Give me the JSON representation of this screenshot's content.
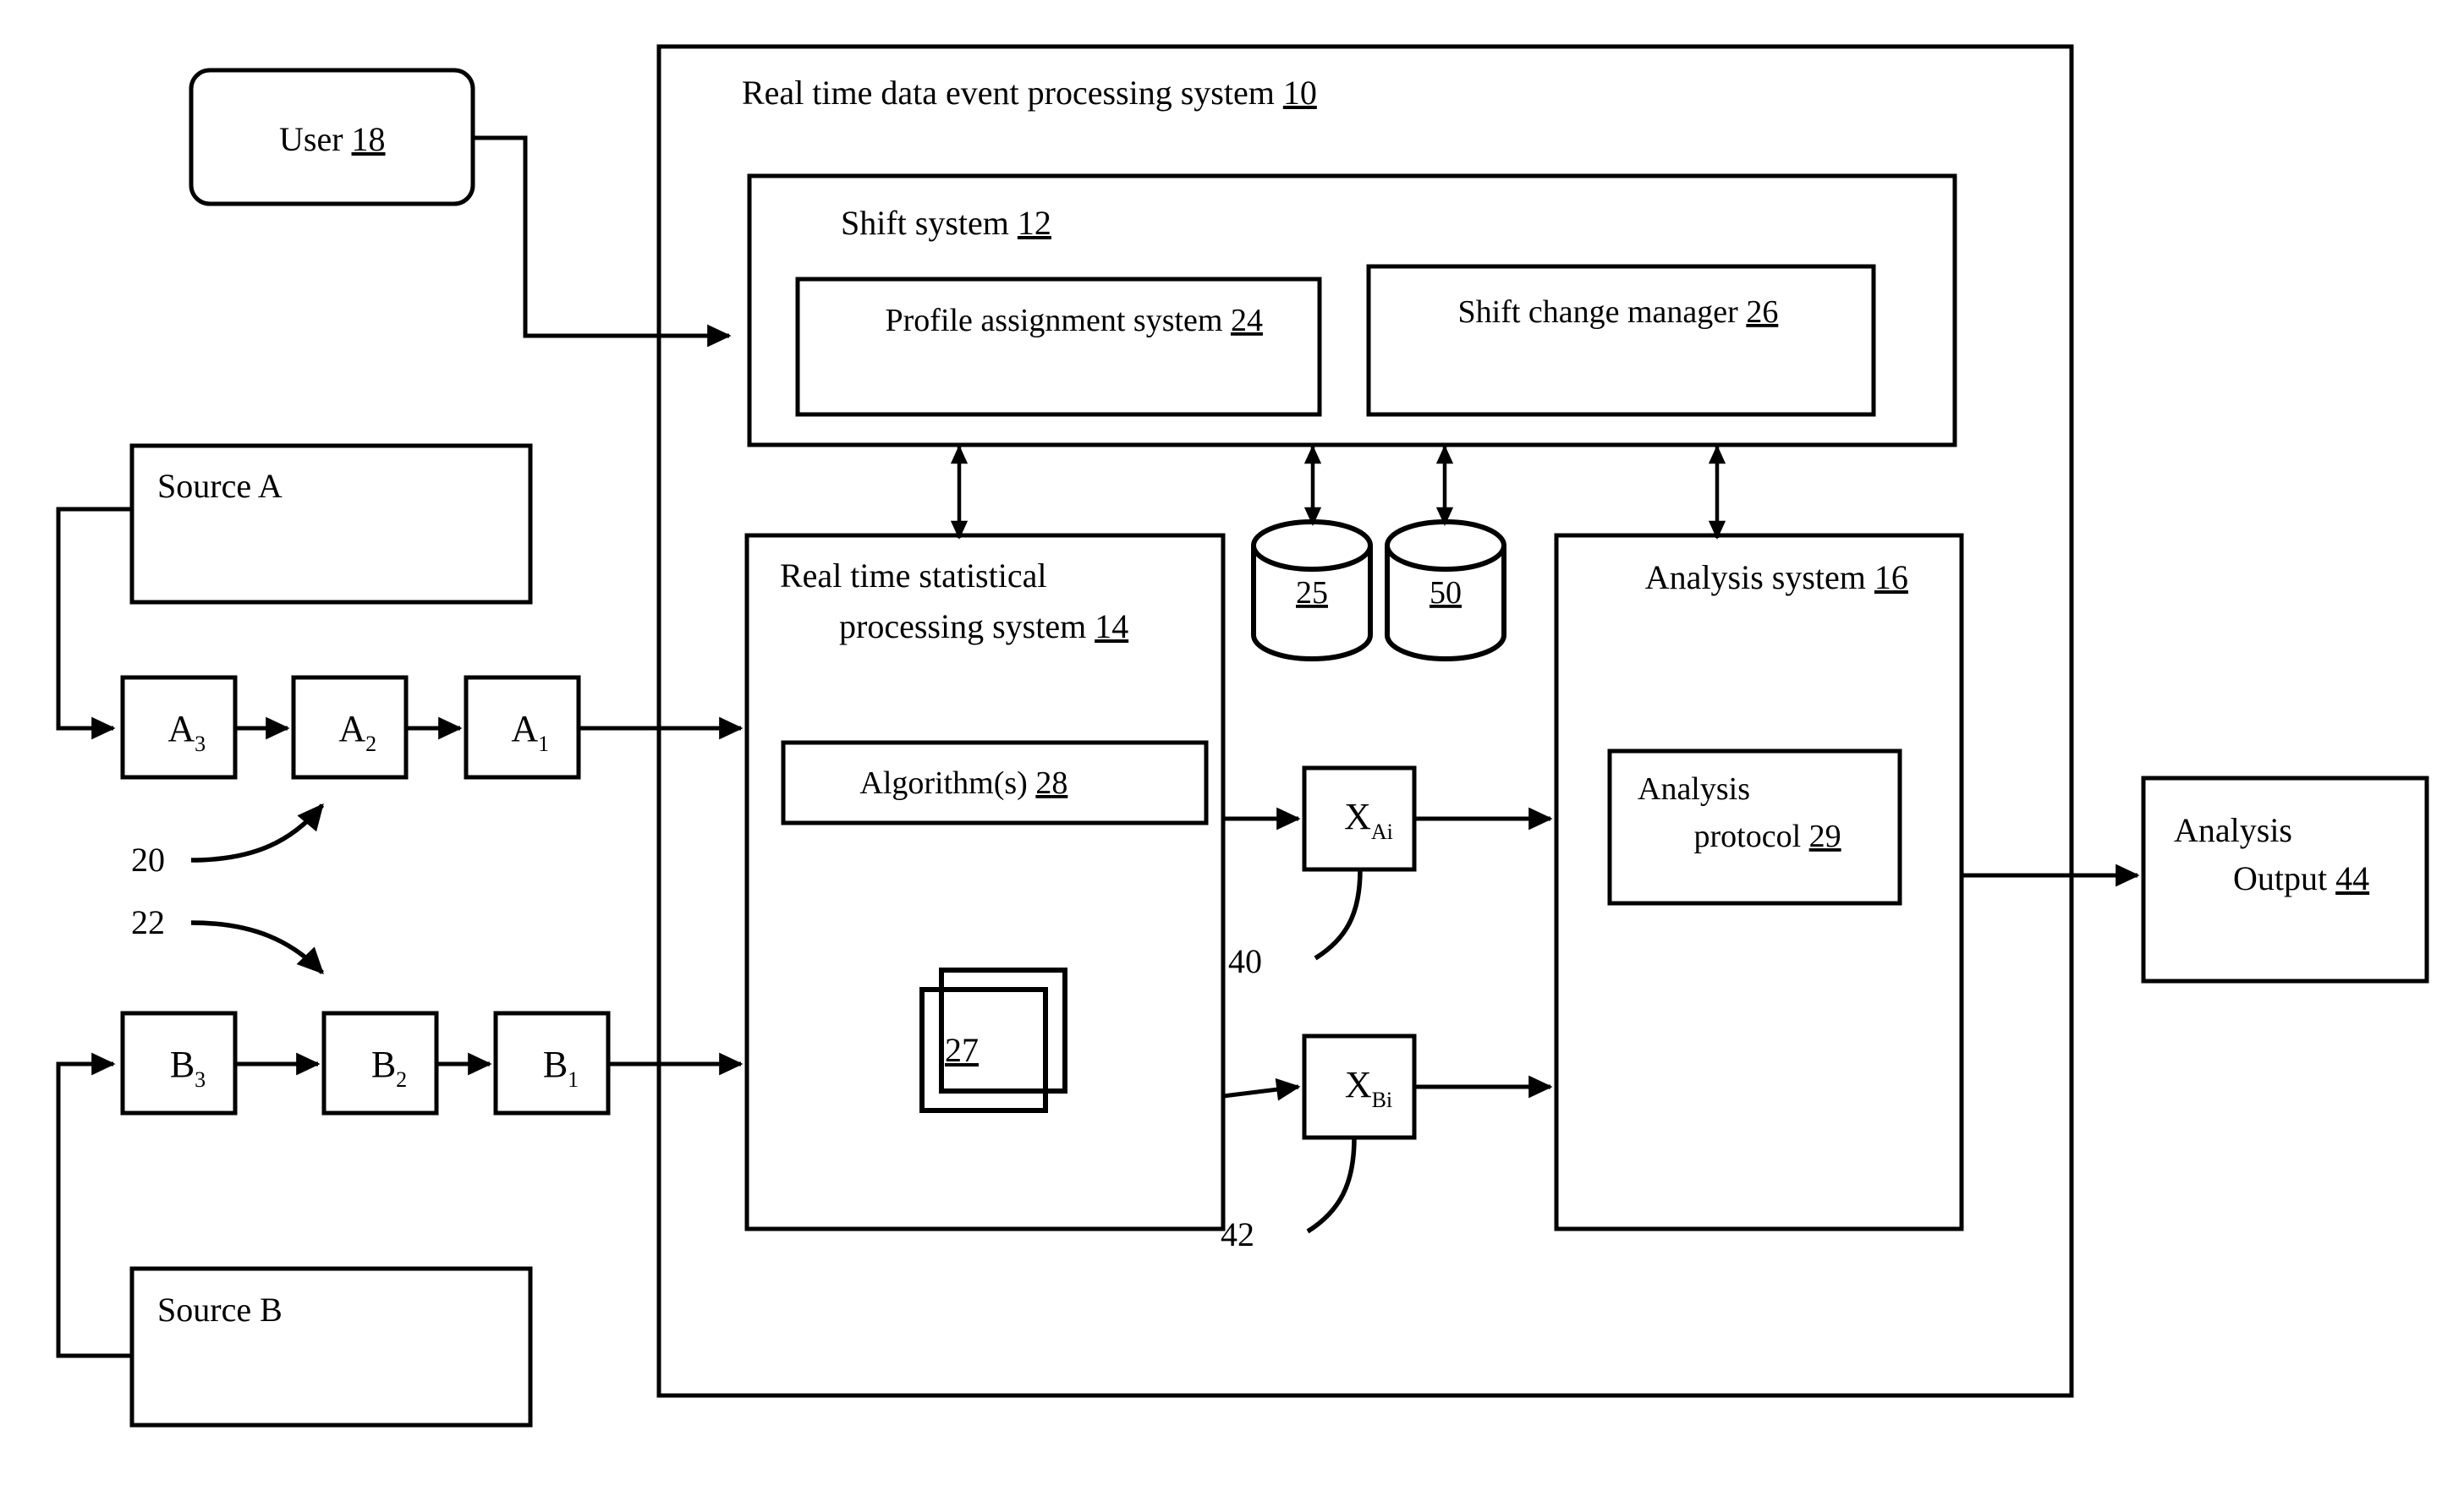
{
  "diagram": {
    "title": "Real time data event processing system 10",
    "figure_type": "patent system block diagram",
    "outer_system": {
      "label_text": "Real time data event processing system",
      "ref_num": "10"
    },
    "user_node": {
      "label_text": "User",
      "ref_num": "18"
    },
    "shift_system": {
      "label_text": "Shift system",
      "ref_num": "12",
      "children": [
        {
          "label_text": "Profile assignment system",
          "ref_num": "24"
        },
        {
          "label_text": "Shift change manager",
          "ref_num": "26"
        }
      ]
    },
    "rtsp_system": {
      "label_line1": "Real time statistical",
      "label_line2": "processing system",
      "ref_num": "14",
      "children": [
        {
          "label_text": "Algorithm(s)",
          "ref_num": "28"
        }
      ],
      "stacked_docs": {
        "ref_num": "27"
      }
    },
    "analysis_system": {
      "label_text": "Analysis system",
      "ref_num": "16",
      "children": [
        {
          "label_line1": "Analysis",
          "label_line2": "protocol",
          "ref_num": "29"
        }
      ]
    },
    "data_stores": [
      {
        "ref_num": "25"
      },
      {
        "ref_num": "50"
      }
    ],
    "sources": [
      {
        "label_text": "Source A"
      },
      {
        "label_text": "Source B"
      }
    ],
    "stream_a": [
      {
        "base": "A",
        "sub": "3"
      },
      {
        "base": "A",
        "sub": "2"
      },
      {
        "base": "A",
        "sub": "1"
      }
    ],
    "stream_b": [
      {
        "base": "B",
        "sub": "3"
      },
      {
        "base": "B",
        "sub": "2"
      },
      {
        "base": "B",
        "sub": "1"
      }
    ],
    "stream_leaders": [
      {
        "ref_num": "20"
      },
      {
        "ref_num": "22"
      }
    ],
    "intermediate_outputs": [
      {
        "base": "X",
        "sub": "Ai",
        "ref_num": "40"
      },
      {
        "base": "X",
        "sub": "Bi",
        "ref_num": "42"
      }
    ],
    "analysis_output": {
      "label_line1": "Analysis",
      "label_line2": "Output",
      "ref_num": "44"
    },
    "colors": {
      "stroke": "#000000",
      "background": "#ffffff"
    }
  }
}
